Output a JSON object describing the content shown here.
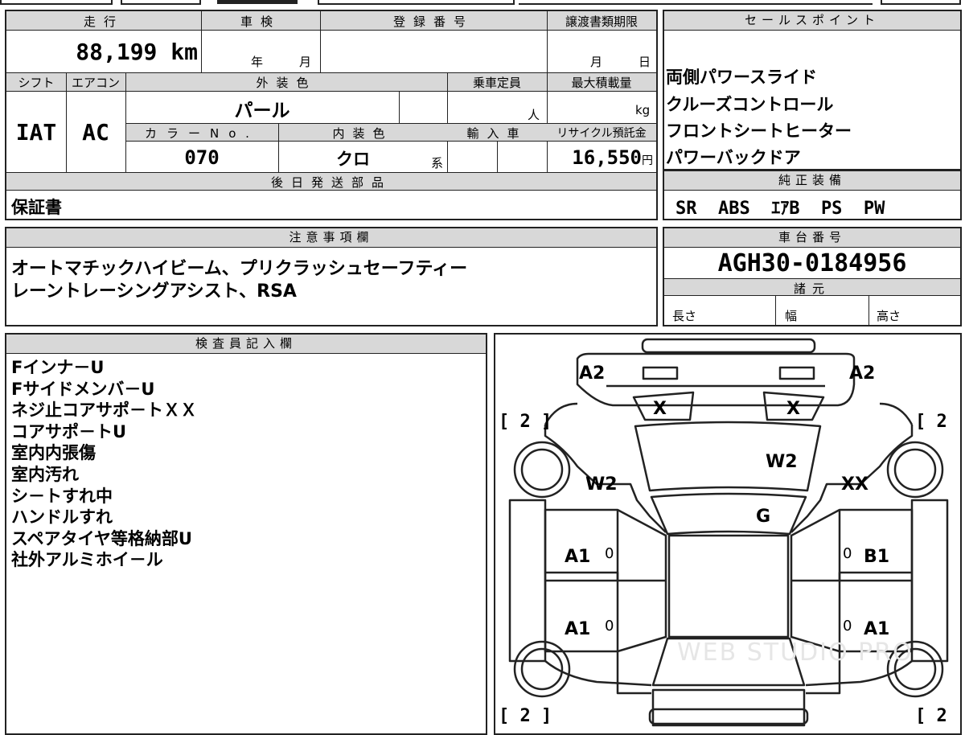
{
  "summary": {
    "mileage_label": "走行",
    "mileage_value": "88,199",
    "mileage_unit": "km",
    "inspection_label": "車検",
    "inspection_year": "年",
    "inspection_month": "月",
    "registration_label": "登録番号",
    "transfer_label": "譲渡書類期限",
    "transfer_month": "月",
    "transfer_day": "日",
    "shift_label": "シフト",
    "shift_value": "IAT",
    "aircon_label": "エアコン",
    "aircon_value": "AC",
    "exterior_label": "外装色",
    "exterior_value": "パール",
    "capacity_label": "乗車定員",
    "capacity_unit": "人",
    "maxload_label": "最大積載量",
    "maxload_unit": "kg",
    "colorno_label": "カラーNo.",
    "colorno_value": "070",
    "interior_label": "内装色",
    "interior_value": "クロ",
    "interior_suffix": "系",
    "import_label": "輸入車",
    "recycle_label": "リサイクル預託金",
    "recycle_value": "16,550",
    "recycle_unit": "円"
  },
  "later_parts": {
    "label": "後日発送部品",
    "value": "保証書"
  },
  "sales_points": {
    "label": "セールスポイント",
    "items": [
      "両側パワースライド",
      "クルーズコントロール",
      "フロントシートヒーター",
      "パワーバックドア"
    ]
  },
  "equipment": {
    "label": "純正装備",
    "value": "SR  ABS  ｴｱB  PS  PW"
  },
  "notes": {
    "label": "注意事項欄",
    "lines": [
      "オートマチックハイビーム、プリクラッシュセーフティー",
      "レーントレーシングアシスト、RSA"
    ]
  },
  "chassis": {
    "label": "車台番号",
    "value": "AGH30-0184956"
  },
  "specs": {
    "label": "諸元",
    "length": "長さ",
    "width": "幅",
    "height": "高さ"
  },
  "inspector": {
    "label": "検査員記入欄",
    "lines": [
      "Fインナ－U",
      "Fサイドメンバ－U",
      "ネジ止コアサポ－トＸＸ",
      "コアサポ－トU",
      "室内内張傷",
      "室内汚れ",
      "シ－トすれ中",
      "ハンドルすれ",
      "スペアタイヤ等格納部U",
      "社外アルミホイ－ル"
    ]
  },
  "diagram": {
    "front_left": "A2",
    "front_right": "A2",
    "lamp_left": "X",
    "lamp_right": "X",
    "bracket_tl": "[ 2 ]",
    "bracket_tr": "[ 2 ]",
    "bracket_bl": "[ 2 ]",
    "bracket_br": "[ 2 ]",
    "fender_left": "W2",
    "hood": "W2",
    "fender_right": "XX",
    "windshield": "G",
    "door_fl": "A1",
    "door_fr": "B1",
    "door_rl": "A1",
    "door_rr": "A1",
    "zero": "0",
    "watermark": "WEB STUDIO PRO"
  }
}
